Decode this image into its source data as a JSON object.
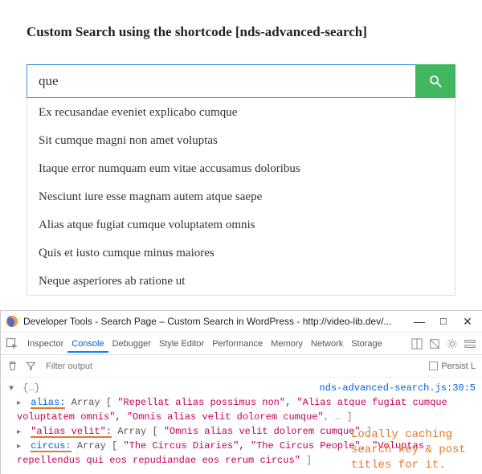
{
  "heading": "Custom Search using the shortcode [nds-advanced-search]",
  "search": {
    "value": "que",
    "results": [
      "Ex recusandae eveniet explicabo cumque",
      "Sit cumque magni non amet voluptas",
      "Itaque error numquam eum vitae accusamus doloribus",
      "Nesciunt iure esse magnam autem atque saepe",
      "Alias atque fugiat cumque voluptatem omnis",
      "Quis et iusto cumque minus maiores",
      "Neque asperiores ab ratione ut"
    ]
  },
  "devtools": {
    "window_title": "Developer Tools - Search Page – Custom Search in WordPress - http://video-lib.dev/...",
    "tabs": [
      "Inspector",
      "Console",
      "Debugger",
      "Style Editor",
      "Performance",
      "Memory",
      "Network",
      "Storage"
    ],
    "active_tab_index": 1,
    "filter_placeholder": "Filter output",
    "persist_label": "Persist L",
    "source": {
      "file": "nds-advanced-search.js",
      "line": "30",
      "col": "5"
    },
    "console": {
      "root": "{…}",
      "entries": [
        {
          "key": "alias:",
          "underlined": true,
          "prefix": "Array [ ",
          "items": [
            "\"Repellat alias possimus non\"",
            "\"Alias atque fugiat cumque voluptatem omnis\"",
            "\"Omnis alias velit dolorem cumque\""
          ],
          "more": ", … ]"
        },
        {
          "key": "\"alias velit\":",
          "underlined": true,
          "prefix": "Array [ ",
          "items": [
            "\"Omnis alias velit dolorem cumque\""
          ],
          "more": " ]"
        },
        {
          "key": "circus:",
          "underlined": true,
          "prefix": "Array [ ",
          "items": [
            "\"The Circus Diaries\"",
            "\"The Circus People\"",
            "\"Voluptas repellendus qui eos repudiandae eos rerum circus\""
          ],
          "more": " ]"
        }
      ]
    },
    "annotation": "Locally caching search key & post titles for it."
  }
}
